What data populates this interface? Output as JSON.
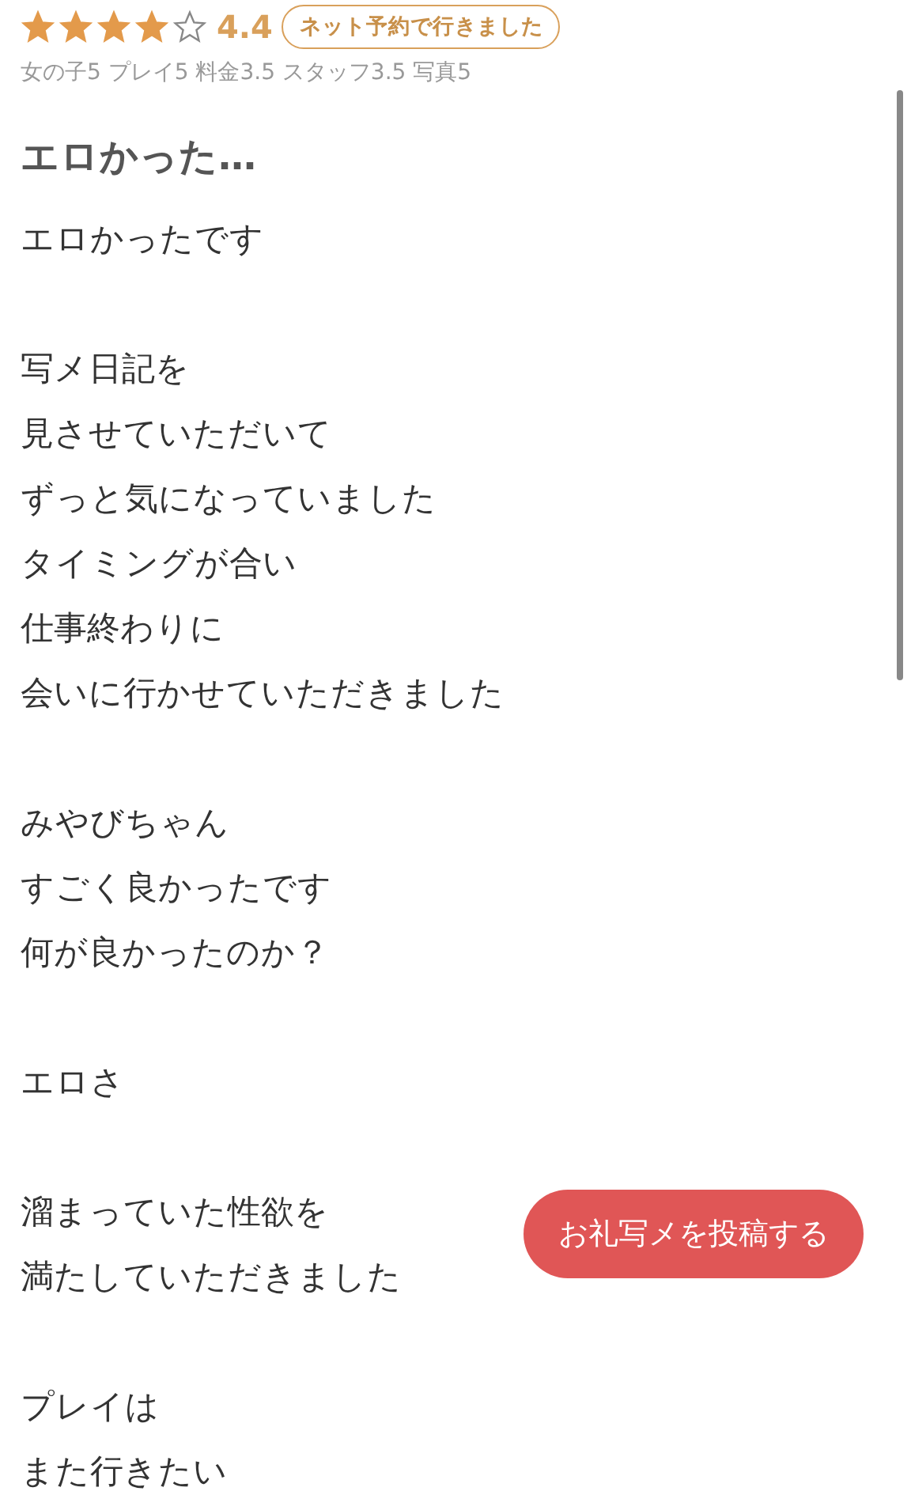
{
  "review": {
    "stars": 4,
    "score": "4.4",
    "badge": "ネット予約で行きました",
    "sub_ratings": "女の子5 プレイ5 料金3.5 スタッフ3.5 写真5",
    "title": "エロかった…",
    "paragraphs": [
      [
        "エロかったです"
      ],
      [
        "写メ日記を",
        "見させていただいて",
        "ずっと気になっていました",
        "タイミングが合い",
        "仕事終わりに",
        "会いに行かせていただきました"
      ],
      [
        "みやびちゃん",
        "すごく良かったです",
        "何が良かったのか？"
      ],
      [
        "エロさ"
      ],
      [
        "溜まっていた性欲を",
        "満たしていただきました"
      ],
      [
        "プレイは",
        "また行きたい"
      ]
    ]
  },
  "post_button": {
    "label": "お礼写メを投稿する"
  }
}
